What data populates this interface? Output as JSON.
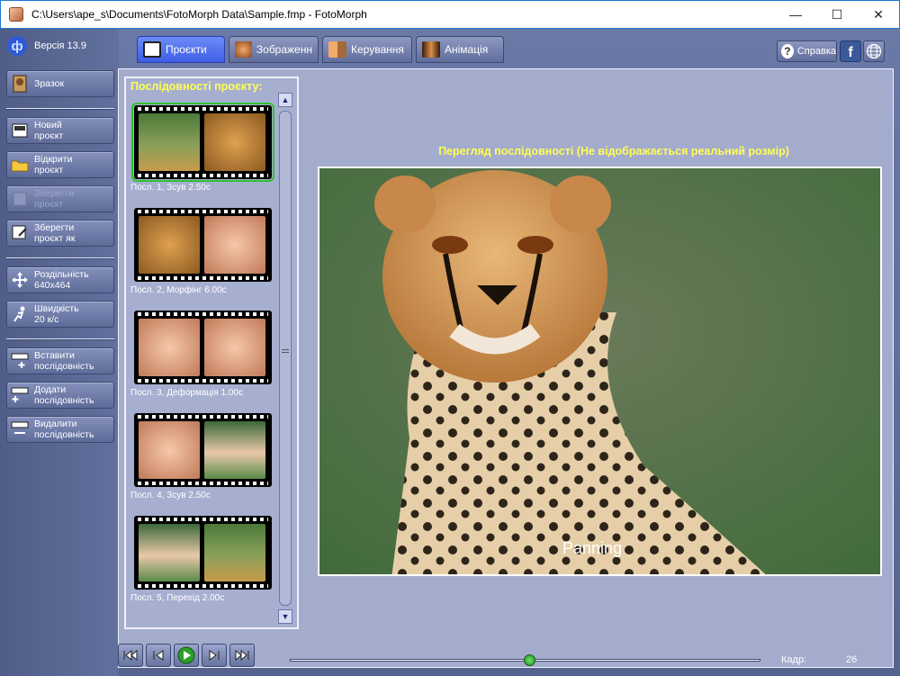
{
  "window": {
    "title": "C:\\Users\\ape_s\\Documents\\FotoMorph Data\\Sample.fmp - FotoMorph"
  },
  "version": "Версія 13.9",
  "sidebar": {
    "sample": "Зразок",
    "new_project": "Новий\nпроєкт",
    "open_project": "Відкрити\nпроєкт",
    "save_project": "Зберегти\nпроєкт",
    "save_project_as": "Зберегти\nпроєкт як",
    "resolution": "Роздільність\n640x464",
    "speed": "Швидкість\n20 к/с",
    "insert_sequence": "Вставити\nпослідовність",
    "add_sequence": "Додати\nпослідовність",
    "delete_sequence": "Видалити\nпослідовність"
  },
  "tabs": [
    {
      "label": "Проєкти"
    },
    {
      "label": "Зображенн"
    },
    {
      "label": "Керування"
    },
    {
      "label": "Анімація"
    }
  ],
  "help_label": "Справка",
  "sequences": {
    "header": "Послідовності проєкту:",
    "items": [
      {
        "label": "Посл. 1,  Зсув 2.50с"
      },
      {
        "label": "Посл. 2,  Морфінг 6.00с"
      },
      {
        "label": "Посл. 3,  Деформація 1.00с"
      },
      {
        "label": "Посл. 4,  Зсув 2.50с"
      },
      {
        "label": "Посл. 5,  Перехід 2.00с"
      }
    ]
  },
  "preview": {
    "title": "Перегляд послідовності (Не відображається реальний розмір)",
    "overlay_text": "Panning"
  },
  "playback": {
    "frame_label": "Кадр:",
    "frame_value": "26",
    "progress": 0.51
  },
  "colors": {
    "accent_header": "#fffd54",
    "selected_outline": "#30c030"
  }
}
